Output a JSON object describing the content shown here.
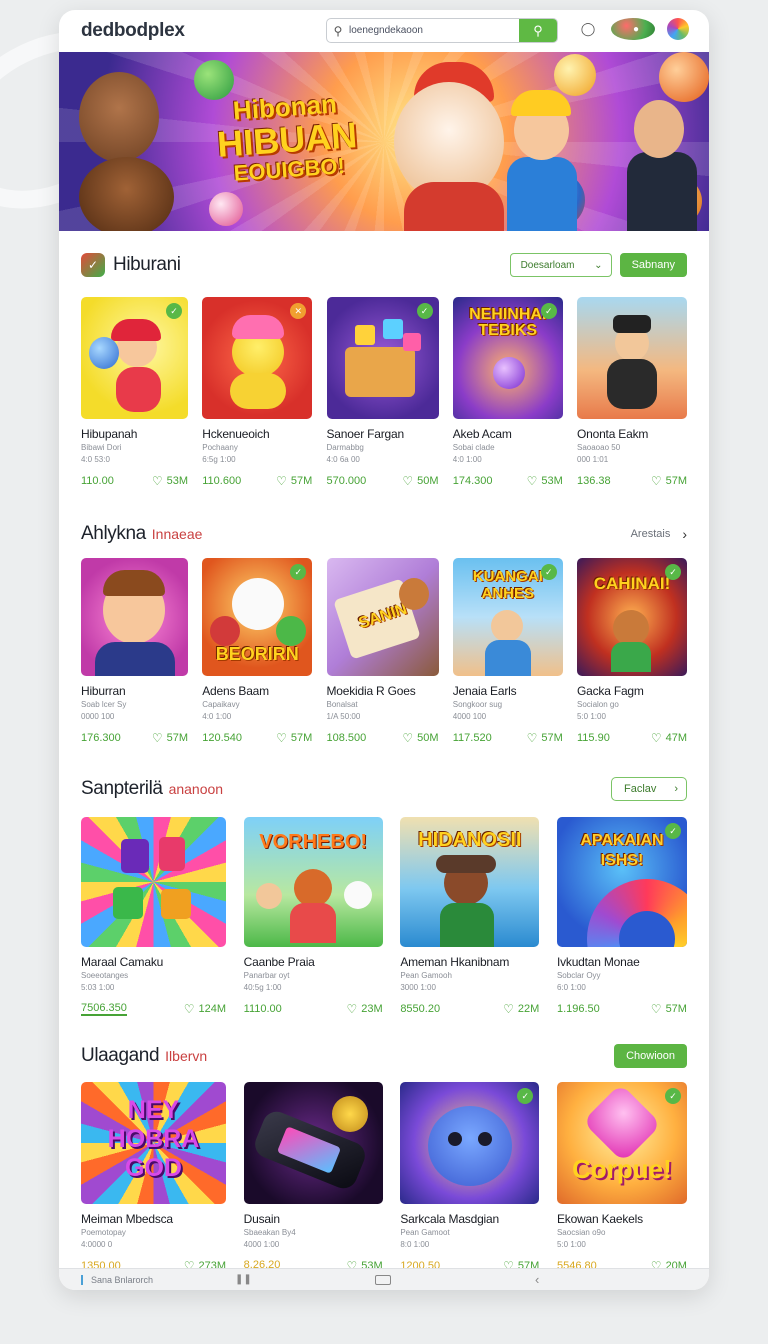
{
  "header": {
    "logo": "dedbodplex",
    "search_placeholder": "loenegndekaoon"
  },
  "banner": {
    "line1": "Hibonan",
    "line2": "HIBUAN",
    "line3": "EOUIGBO!"
  },
  "sections": [
    {
      "title": "Hiburani",
      "subtitle": "",
      "dropdown_label": "Doesarloam",
      "button_label": "Sabnany",
      "items": [
        {
          "name": "Hibupanah",
          "meta1": "Bibawi Dori",
          "meta2": "4:0 53:0",
          "plays": "110.00",
          "likes": "53M"
        },
        {
          "name": "Hckenueoich",
          "meta1": "Pochaany",
          "meta2": "6:5g 1:00",
          "plays": "110.600",
          "likes": "57M"
        },
        {
          "name": "Sanoer Fargan",
          "meta1": "Darmabbg",
          "meta2": "4:0 6a 00",
          "plays": "570.000",
          "likes": "50M"
        },
        {
          "name": "Akeb Acam",
          "meta1": "Sobai clade",
          "meta2": "4:0 1:00",
          "plays": "174.300",
          "likes": "53M"
        },
        {
          "name": "Ononta Eakm",
          "meta1": "Saoaoao 50",
          "meta2": "000 1:01",
          "plays": "136.38",
          "likes": "57M"
        }
      ]
    },
    {
      "title": "Ahlykna",
      "subtitle": "Innaeae",
      "link_label": "Arestais",
      "items": [
        {
          "name": "Hiburran",
          "meta1": "Soab lcer Sy",
          "meta2": "0000 100",
          "plays": "176.300",
          "likes": "57M"
        },
        {
          "name": "Adens Baam",
          "meta1": "Capaikavy",
          "meta2": "4:0 1:00",
          "plays": "120.540",
          "likes": "57M"
        },
        {
          "name": "Moekidia R Goes",
          "meta1": "Bonalsat",
          "meta2": "1/A 50:00",
          "plays": "108.500",
          "likes": "50M"
        },
        {
          "name": "Jenaia Earls",
          "meta1": "Songkoor sug",
          "meta2": "4000 100",
          "plays": "117.520",
          "likes": "57M"
        },
        {
          "name": "Gacka Fagm",
          "meta1": "Socialon go",
          "meta2": "5:0 1:00",
          "plays": "115.90",
          "likes": "47M"
        }
      ]
    },
    {
      "title": "Sanpterilä",
      "subtitle": "ananoon",
      "button_label": "Faclav",
      "items": [
        {
          "name": "Maraal Camaku",
          "meta1": "Soeeotanges",
          "meta2": "5:03 1:00",
          "plays": "7506.350",
          "likes": "124M"
        },
        {
          "name": "Caanbe Praia",
          "meta1": "Panarbar oyt",
          "meta2": "40:5g 1:00",
          "plays": "1110.00",
          "likes": "23M"
        },
        {
          "name": "Ameman Hkanibnam",
          "meta1": "Pean Gamooh",
          "meta2": "3000 1:00",
          "plays": "8550.20",
          "likes": "22M"
        },
        {
          "name": "Ivkudtan Monae",
          "meta1": "Sobclar Oyy",
          "meta2": "6:0 1:00",
          "plays": "1.196.50",
          "likes": "57M"
        }
      ]
    },
    {
      "title": "Ulaagand",
      "subtitle": "Ilbervn",
      "button_label": "Chowioon",
      "items": [
        {
          "name": "Meiman Mbedsca",
          "meta1": "Poemotopay",
          "meta2": "4:0000 0",
          "plays": "1350.00",
          "likes": "273M"
        },
        {
          "name": "Dusain",
          "meta1": "Sbaeakan By4",
          "meta2": "4000 1:00",
          "plays": "8.26.20",
          "likes": "53M"
        },
        {
          "name": "Sarkcala Masdgian",
          "meta1": "Pean Gamoot",
          "meta2": "8:0 1:00",
          "plays": "1200.50",
          "likes": "57M"
        },
        {
          "name": "Ekowan Kaekels",
          "meta1": "Saocsian o9o",
          "meta2": "5:0 1:00",
          "plays": "5546.80",
          "likes": "20M"
        }
      ]
    }
  ],
  "art_text": {
    "s1_4": "NEHINHAI TEBIKS",
    "s2_2": "BEORIRN",
    "s2_3": "SANIN",
    "s2_4": "KUANGAI ANHES",
    "s2_5": "CAHINAI!",
    "s3_2": "VORHEBO!",
    "s3_3": "HIDANOSII",
    "s3_4": "APAKAIAN ISHS!",
    "s4_1": "NEY HOBRA GOD",
    "s4_4": "Corpue!"
  },
  "bottom_bar": {
    "label": "Sana Bnlarorch"
  },
  "colors": {
    "accent": "#5cb543",
    "like": "#47a336",
    "subtitle": "#c94141"
  }
}
